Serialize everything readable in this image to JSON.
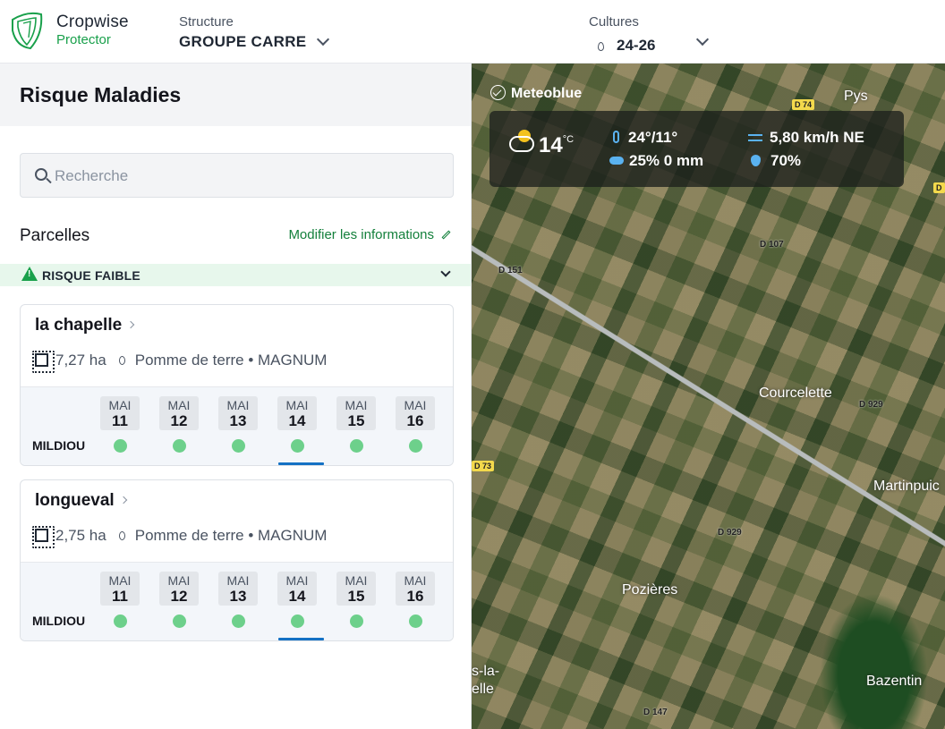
{
  "brand": {
    "name": "Cropwise",
    "product": "Protector"
  },
  "header": {
    "structure_label": "Structure",
    "structure_value": "GROUPE CARRE",
    "cultures_label": "Cultures",
    "cultures_value": "24-26"
  },
  "panel": {
    "title": "Risque Maladies",
    "search_placeholder": "Recherche",
    "parcelles_label": "Parcelles",
    "modify_label": "Modifier les informations",
    "risk_label": "RISQUE FAIBLE"
  },
  "parcels": [
    {
      "name": "la chapelle",
      "area": "7,27 ha",
      "crop": "Pomme de terre • MAGNUM",
      "disease": "MILDIOU",
      "days": [
        {
          "month": "MAI",
          "day": "11"
        },
        {
          "month": "MAI",
          "day": "12"
        },
        {
          "month": "MAI",
          "day": "13"
        },
        {
          "month": "MAI",
          "day": "14"
        },
        {
          "month": "MAI",
          "day": "15"
        },
        {
          "month": "MAI",
          "day": "16"
        }
      ]
    },
    {
      "name": "longueval",
      "area": "2,75 ha",
      "crop": "Pomme de terre • MAGNUM",
      "disease": "MILDIOU",
      "days": [
        {
          "month": "MAI",
          "day": "11"
        },
        {
          "month": "MAI",
          "day": "12"
        },
        {
          "month": "MAI",
          "day": "13"
        },
        {
          "month": "MAI",
          "day": "14"
        },
        {
          "month": "MAI",
          "day": "15"
        },
        {
          "month": "MAI",
          "day": "16"
        }
      ]
    }
  ],
  "weather": {
    "provider": "Meteoblue",
    "temp": "14",
    "temp_unit": "°C",
    "minmax": "24°/11°",
    "rain": "25% 0 mm",
    "wind": "5,80 km/h NE",
    "humidity": "70%"
  },
  "map": {
    "places": {
      "pys": "Pys",
      "courcelette": "Courcelette",
      "martinpuich": "Martinpuic",
      "pozieres": "Pozières",
      "bazentin": "Bazentin",
      "ovillers": "s-la-\nelle"
    },
    "roads": {
      "d74": "D 74",
      "d73": "D 73",
      "d107": "D 107",
      "d151": "D 151",
      "d929a": "D 929",
      "d929b": "D 929",
      "d147": "D 147",
      "d_edge": "D"
    }
  },
  "colors": {
    "accent_green": "#19a04b",
    "risk_bg": "#e7f7ec",
    "dot_green": "#6dd08b",
    "today_blue": "#1471c4"
  }
}
